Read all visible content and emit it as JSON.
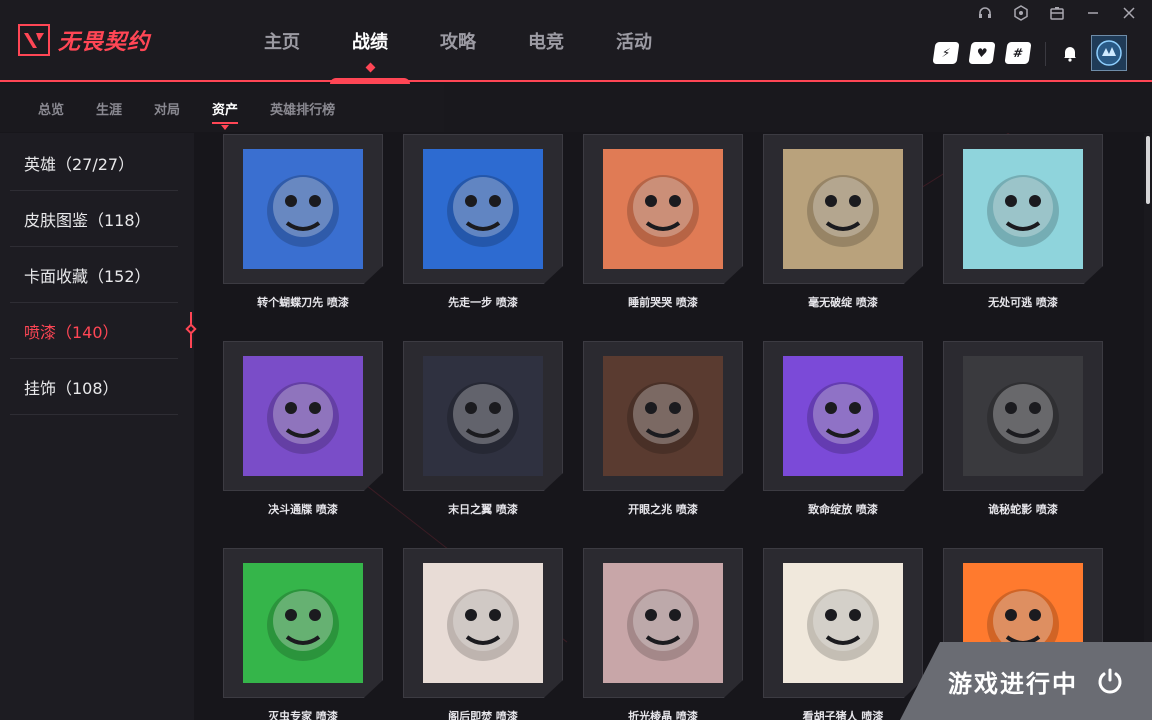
{
  "app": {
    "logo_text": "无畏契约",
    "brand_color": "#ff4655"
  },
  "main_nav": [
    {
      "label": "主页",
      "active": false
    },
    {
      "label": "战绩",
      "active": true
    },
    {
      "label": "攻略",
      "active": false
    },
    {
      "label": "电竞",
      "active": false
    },
    {
      "label": "活动",
      "active": false
    }
  ],
  "window_controls": [
    "headset-icon",
    "settings-icon",
    "toolbox-icon",
    "minimize-icon",
    "close-icon"
  ],
  "social_buttons": [
    "wegame-icon",
    "team-icon",
    "hashtag-icon"
  ],
  "sub_nav": [
    {
      "label": "总览",
      "active": false
    },
    {
      "label": "生涯",
      "active": false
    },
    {
      "label": "对局",
      "active": false
    },
    {
      "label": "资产",
      "active": true
    },
    {
      "label": "英雄排行榜",
      "active": false
    }
  ],
  "sidebar": [
    {
      "label": "英雄（27/27）",
      "active": false
    },
    {
      "label": "皮肤图鉴（118）",
      "active": false
    },
    {
      "label": "卡面收藏（152）",
      "active": false
    },
    {
      "label": "喷漆（140）",
      "active": true
    },
    {
      "label": "挂饰（108）",
      "active": false
    }
  ],
  "sprays": [
    {
      "label": "转个蝴蝶刀先 喷漆",
      "icon": "blue-hair-agent-spray",
      "bg": "#3a6fd0"
    },
    {
      "label": "先走一步 喷漆",
      "icon": "shocked-face-spray",
      "bg": "#2d6bd1"
    },
    {
      "label": "睡前哭哭 喷漆",
      "icon": "crying-face-spray",
      "bg": "#e07b55"
    },
    {
      "label": "毫无破绽 喷漆",
      "icon": "penguin-spray",
      "bg": "#b9a27c"
    },
    {
      "label": "无处可逃 喷漆",
      "icon": "scared-ghost-spray",
      "bg": "#8fd4dc"
    },
    {
      "label": "决斗通牒 喷漆",
      "icon": "dark-hair-agent-spray",
      "bg": "#7a4dc8"
    },
    {
      "label": "末日之翼 喷漆",
      "icon": "helmet-wings-spray",
      "bg": "#2f3140"
    },
    {
      "label": "开眼之兆 喷漆",
      "icon": "coffee-eye-spray",
      "bg": "#5a3b30"
    },
    {
      "label": "致命绽放 喷漆",
      "icon": "yellow-orb-spray",
      "bg": "#7b4ad8"
    },
    {
      "label": "诡秘蛇影 喷漆",
      "icon": "shadow-snake-spray",
      "bg": "#3a3a3e"
    },
    {
      "label": "灭虫专家 喷漆",
      "icon": "no-bug-spray",
      "bg": "#35b54a"
    },
    {
      "label": "阁后即焚 喷漆",
      "icon": "red-target-tower-spray",
      "bg": "#e8dcd6"
    },
    {
      "label": "折光棱晶 喷漆",
      "icon": "prism-crystal-spray",
      "bg": "#c8a6a8"
    },
    {
      "label": "看胡子猪人 喷漆",
      "icon": "bearded-face-spray",
      "bg": "#f0e8dc"
    },
    {
      "label": "",
      "icon": "orange-fish-spray",
      "bg": "#ff7a2e"
    }
  ],
  "status": {
    "playing_text": "游戏进行中"
  }
}
